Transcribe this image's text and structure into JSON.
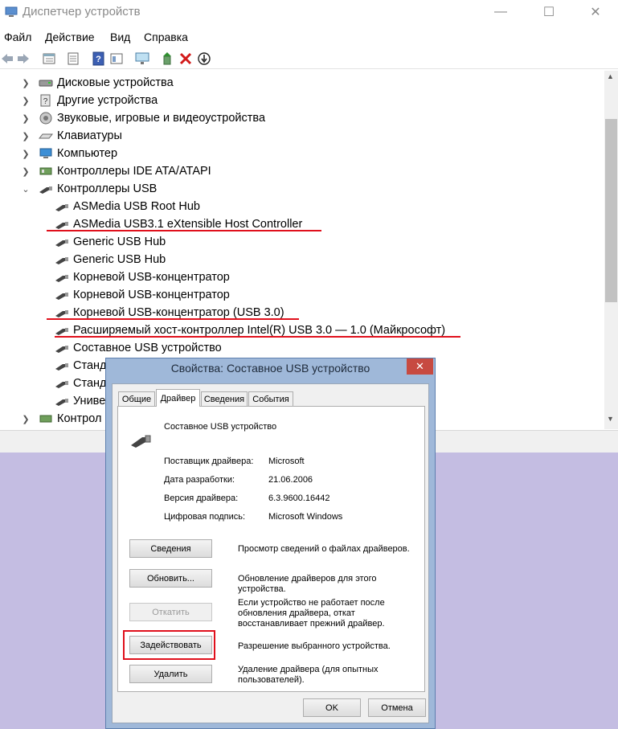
{
  "window": {
    "title": "Диспетчер устройств",
    "controls": {
      "minimize": "—",
      "maximize": "☐",
      "close": "✕"
    }
  },
  "menu": [
    "Файл",
    "Действие",
    "Вид",
    "Справка"
  ],
  "toolbar": [
    "back-icon",
    "forward-icon",
    "properties-grid-icon",
    "list-icon",
    "help-icon",
    "view-icon",
    "monitor-icon",
    "update-driver-icon",
    "uninstall-icon",
    "disable-icon"
  ],
  "tree": {
    "categories_top": [
      {
        "label": "Дисковые устройства",
        "icon": "disk-icon"
      },
      {
        "label": "Другие устройства",
        "icon": "other-devices-icon"
      },
      {
        "label": "Звуковые, игровые и видеоустройства",
        "icon": "speaker-icon"
      },
      {
        "label": "Клавиатуры",
        "icon": "keyboard-icon"
      },
      {
        "label": "Компьютер",
        "icon": "computer-icon"
      },
      {
        "label": "Контроллеры IDE ATA/ATAPI",
        "icon": "ide-icon"
      }
    ],
    "usb_category": "Контроллеры USB",
    "usb_items": [
      "ASMedia USB Root Hub",
      "ASMedia USB3.1 eXtensible Host Controller",
      "Generic USB Hub",
      "Generic USB Hub",
      "Корневой USB-концентратор",
      "Корневой USB-концентратор",
      "Корневой USB-концентратор (USB 3.0)",
      "Расширяемый хост-контроллер Intel(R) USB 3.0 — 1.0 (Майкрософт)",
      "Составное USB устройство",
      "Станд",
      "Станд",
      "Униве"
    ],
    "last_category": "Контрол"
  },
  "dialog": {
    "title": "Свойства: Составное USB устройство",
    "close": "✕",
    "tabs": [
      "Общие",
      "Драйвер",
      "Сведения",
      "События"
    ],
    "device_name": "Составное USB устройство",
    "info": [
      {
        "label": "Поставщик драйвера:",
        "value": "Microsoft"
      },
      {
        "label": "Дата разработки:",
        "value": "21.06.2006"
      },
      {
        "label": "Версия драйвера:",
        "value": "6.3.9600.16442"
      },
      {
        "label": "Цифровая подпись:",
        "value": "Microsoft Windows"
      }
    ],
    "actions": [
      {
        "button": "Сведения",
        "desc": "Просмотр сведений о файлах драйверов."
      },
      {
        "button": "Обновить...",
        "desc": "Обновление драйверов для этого устройства."
      },
      {
        "button": "Откатить",
        "desc": "Если устройство не работает после обновления драйвера, откат восстанавливает прежний драйвер."
      },
      {
        "button": "Задействовать",
        "desc": "Разрешение выбранного устройства."
      },
      {
        "button": "Удалить",
        "desc": "Удаление драйвера (для опытных пользователей)."
      }
    ],
    "ok": "OK",
    "cancel": "Отмена"
  },
  "colors": {
    "highlight": "#e0101c",
    "dialog_frame": "#9fb8d9",
    "desktop": "#c4bde2"
  }
}
